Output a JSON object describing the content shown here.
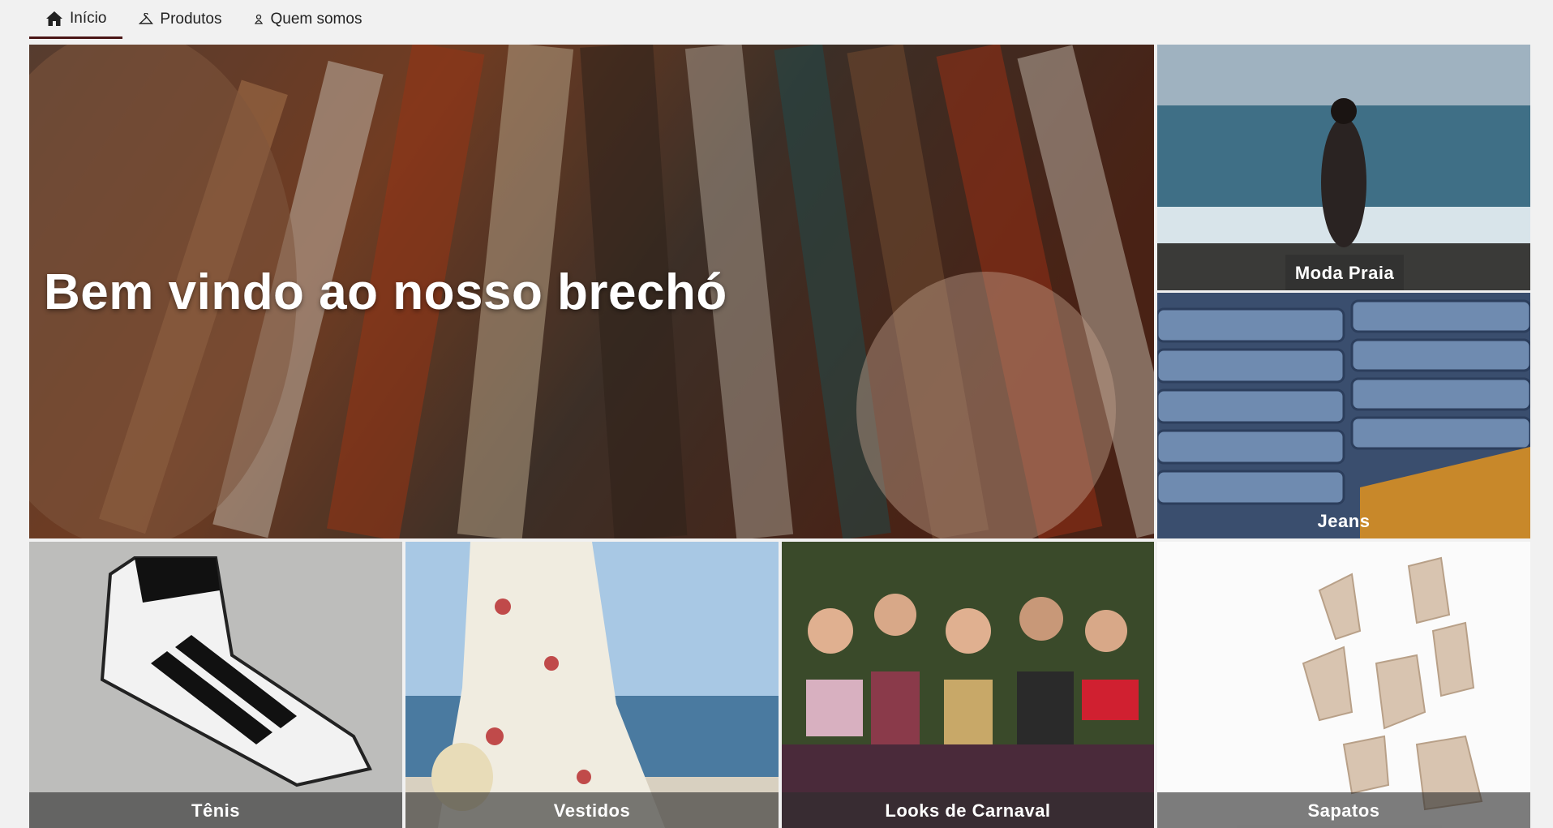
{
  "nav": {
    "items": [
      {
        "label": "Início",
        "icon": "home-icon",
        "active": true
      },
      {
        "label": "Produtos",
        "icon": "hanger-icon",
        "active": false
      },
      {
        "label": "Quem somos",
        "icon": "person-icon",
        "active": false
      }
    ]
  },
  "hero": {
    "title": "Bem vindo ao nosso brechó"
  },
  "categories": [
    {
      "label": "Moda Praia"
    },
    {
      "label": "Jeans"
    },
    {
      "label": "Tênis"
    },
    {
      "label": "Vestidos"
    },
    {
      "label": "Looks de Carnaval"
    },
    {
      "label": "Sapatos"
    }
  ],
  "colors": {
    "accent": "#4a1616",
    "caption_bg": "#2d2d2d",
    "page_bg": "#f1f1f1"
  }
}
